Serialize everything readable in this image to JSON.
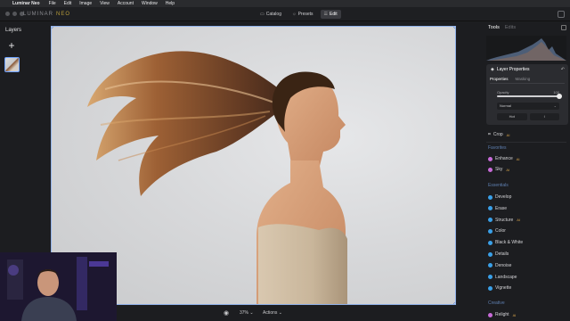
{
  "menubar": {
    "apple": "",
    "app_name": "Luminar Neo",
    "items": [
      "File",
      "Edit",
      "Image",
      "View",
      "Account",
      "Window",
      "Help"
    ]
  },
  "topbar": {
    "brand": "LUMINAR",
    "brand_suffix": "NEO",
    "modes": [
      {
        "label": "Catalog",
        "icon": "folder-icon"
      },
      {
        "label": "Presets",
        "icon": "presets-icon"
      },
      {
        "label": "Edit",
        "icon": "sliders-icon",
        "active": true
      }
    ]
  },
  "left_panel": {
    "title": "Layers",
    "add_label": "+"
  },
  "bottom_bar": {
    "eye_icon": "◉",
    "zoom": "37% ⌄",
    "actions": "Actions ⌄"
  },
  "right_panel": {
    "tabs": [
      {
        "label": "Tools",
        "active": true
      },
      {
        "label": "Edits",
        "active": false
      }
    ],
    "layer_properties": {
      "title": "Layer Properties",
      "undo_icon": "↶",
      "tabs": [
        {
          "label": "Properties",
          "active": true
        },
        {
          "label": "Masking",
          "active": false
        }
      ],
      "opacity_label": "Opacity",
      "opacity_value": "100",
      "opacity_fraction": 1.0,
      "blend_mode": "Normal",
      "button_left": "Hot",
      "button_right": "↕"
    },
    "crop_label": "Crop",
    "sections": {
      "favorites": "Favorites",
      "essentials": "Essentials",
      "creative": "Creative"
    },
    "favorites": [
      {
        "label": "Enhance",
        "color": "#c86bd8",
        "badge": "AI"
      },
      {
        "label": "Sky",
        "color": "#c86bd8",
        "badge": "AI"
      }
    ],
    "essentials": [
      {
        "label": "Develop",
        "color": "#3aa0e8",
        "badge": ""
      },
      {
        "label": "Erase",
        "color": "#3aa0e8",
        "badge": ""
      },
      {
        "label": "Structure",
        "color": "#3aa0e8",
        "badge": "AI"
      },
      {
        "label": "Color",
        "color": "#3aa0e8",
        "badge": ""
      },
      {
        "label": "Black & White",
        "color": "#3aa0e8",
        "badge": ""
      },
      {
        "label": "Details",
        "color": "#3aa0e8",
        "badge": ""
      },
      {
        "label": "Denoise",
        "color": "#3aa0e8",
        "badge": ""
      },
      {
        "label": "Landscape",
        "color": "#3aa0e8",
        "badge": ""
      },
      {
        "label": "Vignette",
        "color": "#3aa0e8",
        "badge": ""
      }
    ],
    "creative": [
      {
        "label": "Relight",
        "color": "#c86bd8",
        "badge": "AI"
      }
    ]
  },
  "colors": {
    "accent_blue": "#6fa3ff",
    "essentials_blue": "#3aa0e8",
    "ai_badge": "#d4a24a",
    "section_label": "#5e7fb0"
  }
}
